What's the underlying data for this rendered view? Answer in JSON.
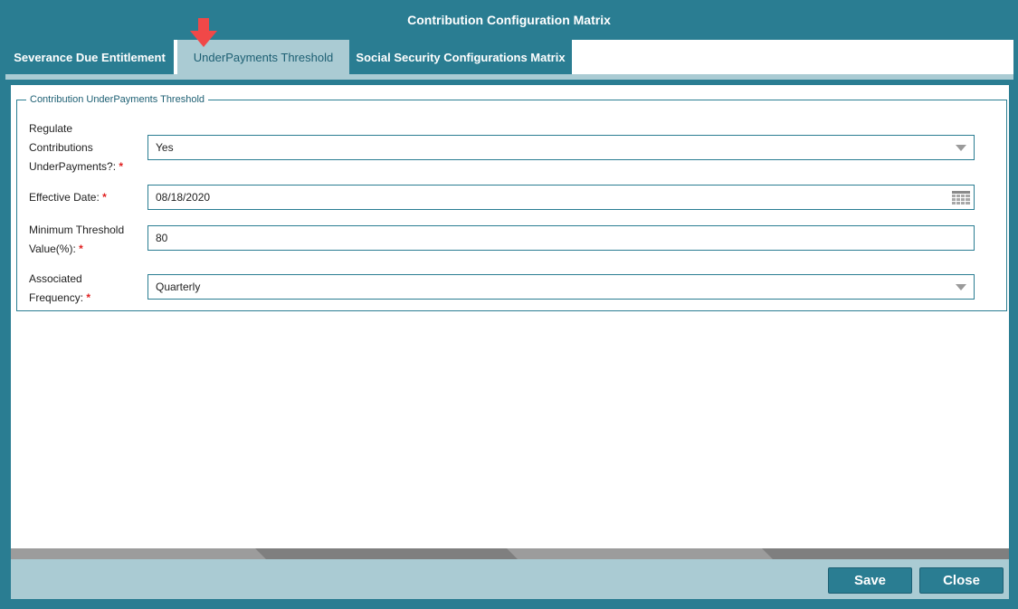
{
  "window": {
    "title": "Contribution Configuration Matrix"
  },
  "tabs": [
    {
      "label": "Severance Due Entitlement",
      "active": false
    },
    {
      "label": "UnderPayments Threshold",
      "active": true
    },
    {
      "label": "Social Security Configurations Matrix",
      "active": false
    }
  ],
  "section": {
    "legend": "Contribution UnderPayments Threshold",
    "fields": {
      "regulate": {
        "label_lines": [
          "Regulate",
          "Contributions",
          "UnderPayments?:"
        ],
        "value": "Yes",
        "required_mark": "*"
      },
      "effective_date": {
        "label": "Effective Date:",
        "value": "08/18/2020",
        "required_mark": "*"
      },
      "min_threshold": {
        "label_lines": [
          "Minimum Threshold",
          "Value(%):"
        ],
        "value": "80",
        "required_mark": "*"
      },
      "frequency": {
        "label_lines": [
          "Associated",
          "Frequency:"
        ],
        "value": "Quarterly",
        "required_mark": "*"
      }
    }
  },
  "footer": {
    "save_label": "Save",
    "close_label": "Close"
  },
  "colors": {
    "primary": "#2a7d92",
    "light": "#aacbd3",
    "required": "#e02020",
    "arrow": "#f04848"
  },
  "icons": {
    "tab_pointer": "arrow-down-icon",
    "date_picker": "calendar-icon",
    "dropdown": "chevron-down-icon"
  }
}
